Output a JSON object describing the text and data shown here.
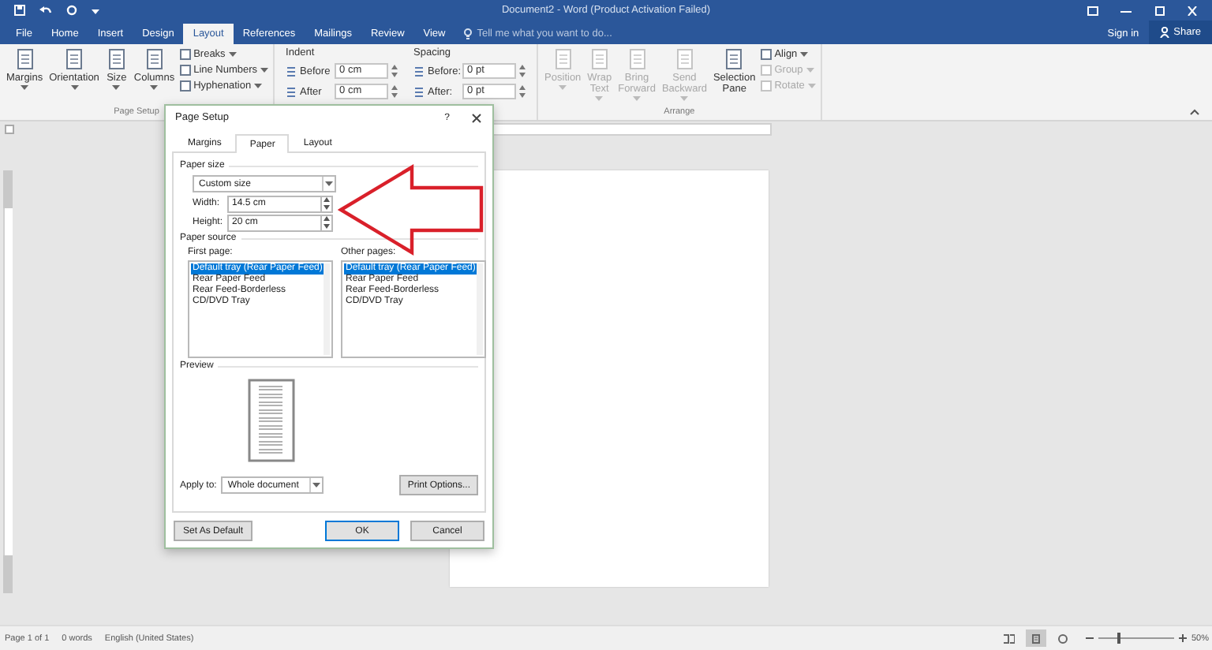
{
  "window": {
    "title": "Document2 - Word (Product Activation Failed)"
  },
  "tabs": [
    {
      "label": "File",
      "selected": false
    },
    {
      "label": "Home",
      "selected": false
    },
    {
      "label": "Insert",
      "selected": false
    },
    {
      "label": "Design",
      "selected": false
    },
    {
      "label": "Layout",
      "selected": true
    },
    {
      "label": "References",
      "selected": false
    },
    {
      "label": "Mailings",
      "selected": false
    },
    {
      "label": "Review",
      "selected": false
    },
    {
      "label": "View",
      "selected": false
    }
  ],
  "tell_me": {
    "placeholder": "Tell me what you want to do..."
  },
  "account": {
    "sign_in": "Sign in",
    "share": "Share"
  },
  "ribbon": {
    "page_setup": {
      "label": "Page Setup",
      "large_buttons": [
        {
          "label": "Margins",
          "dropdown": true
        },
        {
          "label": "Orientation",
          "dropdown": true
        },
        {
          "label": "Size",
          "dropdown": true
        },
        {
          "label": "Columns",
          "dropdown": true
        }
      ],
      "small_buttons": [
        {
          "label": "Breaks",
          "dropdown": true
        },
        {
          "label": "Line Numbers",
          "dropdown": true
        },
        {
          "label": "Hyphenation",
          "dropdown": true
        }
      ]
    },
    "paragraph": {
      "indent": {
        "label": "Indent",
        "fields": [
          {
            "label": "Before",
            "value": "0 cm"
          },
          {
            "label": "After",
            "value": "0 cm"
          }
        ]
      },
      "spacing": {
        "label": "Spacing",
        "fields": [
          {
            "label": "Before:",
            "value": "0 pt"
          },
          {
            "label": "After:",
            "value": "0 pt"
          }
        ]
      }
    },
    "arrange": {
      "label": "Arrange",
      "large_buttons": [
        {
          "label": "Position",
          "disabled": true,
          "dropdown": true
        },
        {
          "label": "Wrap Text",
          "disabled": true,
          "dropdown": true
        },
        {
          "label": "Bring Forward",
          "disabled": true,
          "dropdown": true
        },
        {
          "label": "Send Backward",
          "disabled": true,
          "dropdown": true
        },
        {
          "label": "Selection Pane",
          "disabled": false,
          "dropdown": false
        }
      ],
      "small_buttons": [
        {
          "label": "Align",
          "disabled": false
        },
        {
          "label": "Group",
          "disabled": true
        },
        {
          "label": "Rotate",
          "disabled": true
        }
      ]
    }
  },
  "dialog": {
    "title": "Page Setup",
    "help": "?",
    "tabs": [
      {
        "label": "Margins",
        "selected": false
      },
      {
        "label": "Paper",
        "selected": true
      },
      {
        "label": "Layout",
        "selected": false
      }
    ],
    "paper_size": {
      "label": "Paper size",
      "value": "Custom size",
      "width": {
        "label": "Width:",
        "value": "14.5 cm"
      },
      "height": {
        "label": "Height:",
        "value": "20 cm"
      }
    },
    "paper_source": {
      "label": "Paper source",
      "lists": [
        {
          "label": "First page:",
          "items": [
            {
              "label": "Default tray (Rear Paper Feed)",
              "selected": true
            },
            {
              "label": "Rear Paper Feed",
              "selected": false
            },
            {
              "label": "Rear Feed-Borderless",
              "selected": false
            },
            {
              "label": "CD/DVD Tray",
              "selected": false
            }
          ]
        },
        {
          "label": "Other pages:",
          "items": [
            {
              "label": "Default tray (Rear Paper Feed)",
              "selected": true
            },
            {
              "label": "Rear Paper Feed",
              "selected": false
            },
            {
              "label": "Rear Feed-Borderless",
              "selected": false
            },
            {
              "label": "CD/DVD Tray",
              "selected": false
            }
          ]
        }
      ]
    },
    "preview": {
      "label": "Preview"
    },
    "apply_to": {
      "label": "Apply to:",
      "value": "Whole document"
    },
    "print_options": "Print Options...",
    "buttons": [
      {
        "label": "Set As Default",
        "default": false
      },
      {
        "label": "OK",
        "default": true
      },
      {
        "label": "Cancel",
        "default": false
      }
    ]
  },
  "status_bar": {
    "page": "Page 1 of 1",
    "words": "0 words",
    "language": "English (United States)",
    "views": [
      {
        "selected": false
      },
      {
        "selected": true
      },
      {
        "selected": false
      }
    ],
    "zoom": {
      "level": 0.28,
      "label": "50%"
    }
  }
}
